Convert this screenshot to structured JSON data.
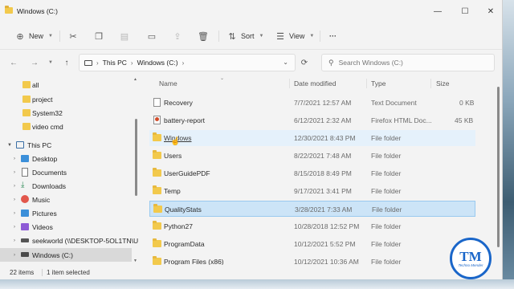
{
  "window": {
    "title": "Windows (C:)",
    "controls": {
      "minimize": "—",
      "maximize": "☐",
      "close": "✕"
    }
  },
  "toolbar": {
    "new_label": "New",
    "sort_label": "Sort",
    "view_label": "View",
    "more_label": "···"
  },
  "address": {
    "segments": [
      "This PC",
      "Windows (C:)"
    ],
    "search_placeholder": "Search Windows (C:)"
  },
  "sidebar": {
    "items": [
      {
        "label": "all",
        "icon": "folder-icon"
      },
      {
        "label": "project",
        "icon": "folder-icon"
      },
      {
        "label": "System32",
        "icon": "folder-icon"
      },
      {
        "label": "video cmd",
        "icon": "folder-icon"
      },
      {
        "label": "This PC",
        "icon": "pc-icon"
      },
      {
        "label": "Desktop",
        "icon": "desktop-icon"
      },
      {
        "label": "Documents",
        "icon": "documents-icon"
      },
      {
        "label": "Downloads",
        "icon": "downloads-icon"
      },
      {
        "label": "Music",
        "icon": "music-icon"
      },
      {
        "label": "Pictures",
        "icon": "pictures-icon"
      },
      {
        "label": "Videos",
        "icon": "videos-icon"
      },
      {
        "label": "seekworld (\\\\DESKTOP-5OL1TN\\U",
        "icon": "network-drive-icon"
      },
      {
        "label": "Windows (C:)",
        "icon": "drive-icon"
      }
    ]
  },
  "columns": {
    "name": "Name",
    "date": "Date modified",
    "type": "Type",
    "size": "Size"
  },
  "files": [
    {
      "name": "Recovery",
      "date": "7/7/2021 12:57 AM",
      "type": "Text Document",
      "size": "0 KB",
      "icon": "text-file-icon"
    },
    {
      "name": "battery-report",
      "date": "6/12/2021 2:32 AM",
      "type": "Firefox HTML Doc...",
      "size": "45 KB",
      "icon": "html-file-icon"
    },
    {
      "name": "Windows",
      "date": "12/30/2021 8:43 PM",
      "type": "File folder",
      "size": "",
      "icon": "folder-icon"
    },
    {
      "name": "Users",
      "date": "8/22/2021 7:48 AM",
      "type": "File folder",
      "size": "",
      "icon": "folder-icon"
    },
    {
      "name": "UserGuidePDF",
      "date": "8/15/2018 8:49 PM",
      "type": "File folder",
      "size": "",
      "icon": "folder-icon"
    },
    {
      "name": "Temp",
      "date": "9/17/2021 3:41 PM",
      "type": "File folder",
      "size": "",
      "icon": "folder-icon"
    },
    {
      "name": "QualityStats",
      "date": "3/28/2021 7:33 AM",
      "type": "File folder",
      "size": "",
      "icon": "folder-icon"
    },
    {
      "name": "Python27",
      "date": "10/28/2018 12:52 PM",
      "type": "File folder",
      "size": "",
      "icon": "folder-icon"
    },
    {
      "name": "ProgramData",
      "date": "10/12/2021 5:52 PM",
      "type": "File folder",
      "size": "",
      "icon": "folder-icon"
    },
    {
      "name": "Program Files (x86)",
      "date": "10/12/2021 10:36 AM",
      "type": "File folder",
      "size": "",
      "icon": "folder-icon"
    }
  ],
  "status": {
    "count": "22 items",
    "selection": "1 item selected"
  },
  "logo": {
    "letters": "TM",
    "tagline": "Techno Mender"
  },
  "colors": {
    "accent": "#1a66c9",
    "selection": "#cce4f7",
    "hover": "#e5f1fb",
    "folder": "#f2c94c"
  }
}
